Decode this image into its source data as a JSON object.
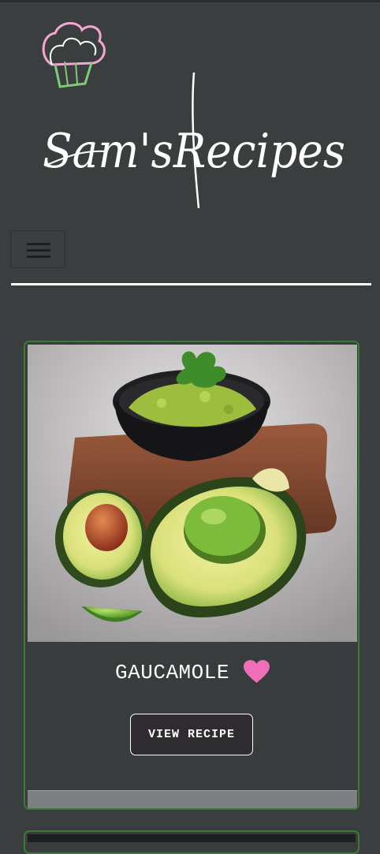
{
  "brand": {
    "name": "Sam's Recipes",
    "logo_text": "Sam'sRecipes"
  },
  "nav": {
    "toggler_icon": "hamburger-icon"
  },
  "recipe_card": {
    "image_icon": "guacamole-photo",
    "title": "GAUCAMOLE",
    "favorite_icon": "heart-icon",
    "heart_color": "#f06db7",
    "view_button_label": "VIEW RECIPE"
  },
  "colors": {
    "background": "#3b3e3f",
    "card_border": "#3c7a34",
    "divider": "#ffffff"
  }
}
